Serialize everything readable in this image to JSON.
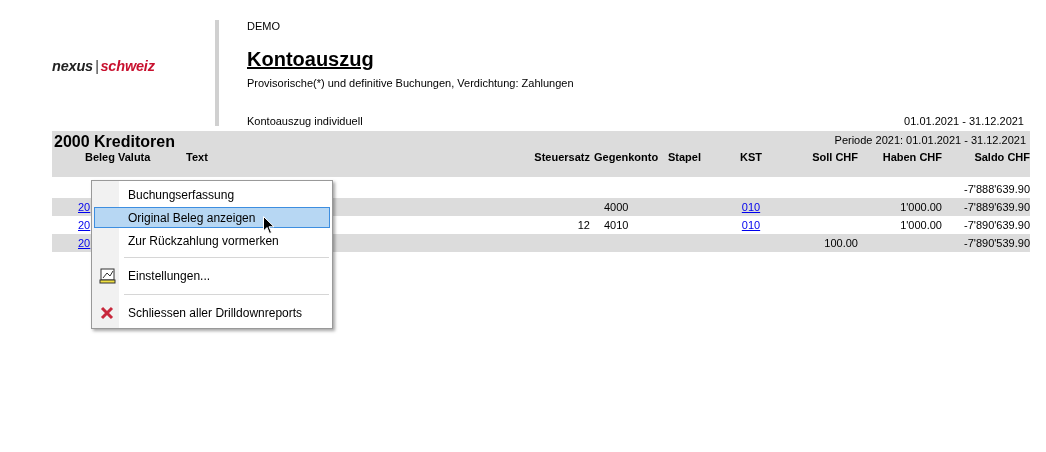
{
  "header": {
    "logo": {
      "first": "nexus",
      "separator": "|",
      "second": "schweiz"
    },
    "company": "DEMO",
    "title": "Kontoauszug",
    "subtitle": "Provisorische(*) und definitive Buchungen, Verdichtung: Zahlungen",
    "report_name": "Kontoauszug individuell",
    "date_range": "01.01.2021 - 31.12.2021"
  },
  "account": {
    "title": "2000 Kreditoren",
    "period": "Periode 2021: 01.01.2021 - 31.12.2021"
  },
  "table": {
    "columns": [
      "Beleg",
      "Valuta",
      "Text",
      "Steuersatz",
      "Gegenkonto",
      "Stapel",
      "KST",
      "Soll CHF",
      "Haben CHF",
      "Saldo CHF"
    ],
    "rows": [
      {
        "beleg": "",
        "steuersatz": "",
        "gegenkonto": "",
        "kst": "",
        "soll": "",
        "haben": "",
        "saldo": "-7'888'639.90"
      },
      {
        "beleg": "20",
        "steuersatz": "",
        "gegenkonto": "4000",
        "kst": "010",
        "soll": "",
        "haben": "1'000.00",
        "saldo": "-7'889'639.90"
      },
      {
        "beleg": "20",
        "steuersatz": "12",
        "gegenkonto": "4010",
        "kst": "010",
        "soll": "",
        "haben": "1'000.00",
        "saldo": "-7'890'639.90"
      },
      {
        "beleg": "20",
        "steuersatz": "",
        "gegenkonto": "",
        "kst": "",
        "soll": "100.00",
        "haben": "",
        "saldo": "-7'890'539.90"
      }
    ]
  },
  "context_menu": {
    "items": [
      {
        "kind": "item",
        "label": "Buchungserfassung",
        "selected": false
      },
      {
        "kind": "item",
        "label": "Original Beleg anzeigen",
        "selected": true
      },
      {
        "kind": "item",
        "label": "Zur Rückzahlung vormerken",
        "selected": false
      },
      {
        "kind": "separator"
      },
      {
        "kind": "settings",
        "label": "Einstellungen...",
        "selected": false
      },
      {
        "kind": "separator"
      },
      {
        "kind": "close",
        "label": "Schliessen aller Drilldownreports",
        "selected": false
      }
    ]
  }
}
